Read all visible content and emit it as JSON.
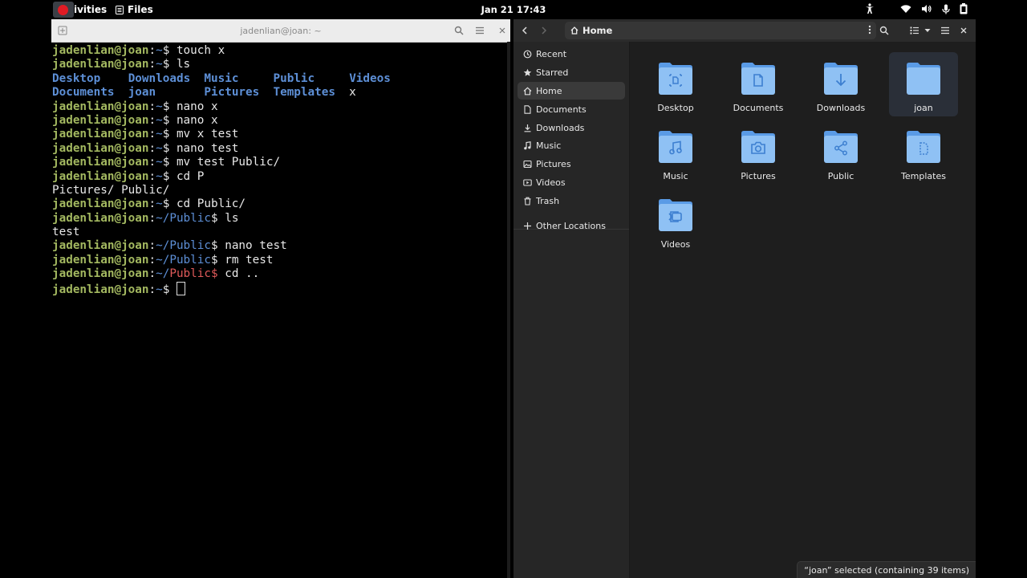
{
  "topbar": {
    "activities": "ivities",
    "app_menu": "Files",
    "clock": "Jan 21  17:43"
  },
  "terminal": {
    "title": "jadenlian@joan: ~",
    "lines": [
      [
        {
          "t": "jadenlian@joan",
          "c": "u"
        },
        {
          "t": ":"
        },
        {
          "t": "~",
          "c": "p"
        },
        {
          "t": "$ touch x"
        }
      ],
      [
        {
          "t": "jadenlian@joan",
          "c": "u"
        },
        {
          "t": ":"
        },
        {
          "t": "~",
          "c": "p"
        },
        {
          "t": "$ ls"
        }
      ],
      [
        {
          "t": "Desktop",
          "c": "dir"
        },
        {
          "t": "    "
        },
        {
          "t": "Downloads",
          "c": "dir"
        },
        {
          "t": "  "
        },
        {
          "t": "Music",
          "c": "dir"
        },
        {
          "t": "     "
        },
        {
          "t": "Public",
          "c": "dir"
        },
        {
          "t": "     "
        },
        {
          "t": "Videos",
          "c": "dir"
        }
      ],
      [
        {
          "t": "Documents",
          "c": "dir"
        },
        {
          "t": "  "
        },
        {
          "t": "joan",
          "c": "dir"
        },
        {
          "t": "       "
        },
        {
          "t": "Pictures",
          "c": "dir"
        },
        {
          "t": "  "
        },
        {
          "t": "Templates",
          "c": "dir"
        },
        {
          "t": "  x"
        }
      ],
      [
        {
          "t": "jadenlian@joan",
          "c": "u"
        },
        {
          "t": ":"
        },
        {
          "t": "~",
          "c": "p"
        },
        {
          "t": "$ nano x"
        }
      ],
      [
        {
          "t": "jadenlian@joan",
          "c": "u"
        },
        {
          "t": ":"
        },
        {
          "t": "~",
          "c": "p"
        },
        {
          "t": "$ nano x"
        }
      ],
      [
        {
          "t": "jadenlian@joan",
          "c": "u"
        },
        {
          "t": ":"
        },
        {
          "t": "~",
          "c": "p"
        },
        {
          "t": "$ mv x test"
        }
      ],
      [
        {
          "t": "jadenlian@joan",
          "c": "u"
        },
        {
          "t": ":"
        },
        {
          "t": "~",
          "c": "p"
        },
        {
          "t": "$ nano test"
        }
      ],
      [
        {
          "t": "jadenlian@joan",
          "c": "u"
        },
        {
          "t": ":"
        },
        {
          "t": "~",
          "c": "p"
        },
        {
          "t": "$ mv test Public/"
        }
      ],
      [
        {
          "t": "jadenlian@joan",
          "c": "u"
        },
        {
          "t": ":"
        },
        {
          "t": "~",
          "c": "p"
        },
        {
          "t": "$ cd P"
        }
      ],
      [
        {
          "t": "Pictures/ Public/"
        }
      ],
      [
        {
          "t": "jadenlian@joan",
          "c": "u"
        },
        {
          "t": ":"
        },
        {
          "t": "~",
          "c": "p"
        },
        {
          "t": "$ cd Public/"
        }
      ],
      [
        {
          "t": "jadenlian@joan",
          "c": "u"
        },
        {
          "t": ":"
        },
        {
          "t": "~/Public",
          "c": "p"
        },
        {
          "t": "$ ls"
        }
      ],
      [
        {
          "t": "test"
        }
      ],
      [
        {
          "t": "jadenlian@joan",
          "c": "u"
        },
        {
          "t": ":"
        },
        {
          "t": "~/Public",
          "c": "p"
        },
        {
          "t": "$ nano test"
        }
      ],
      [
        {
          "t": "jadenlian@joan",
          "c": "u"
        },
        {
          "t": ":"
        },
        {
          "t": "~/Public",
          "c": "p"
        },
        {
          "t": "$ rm test"
        }
      ],
      [
        {
          "t": "jadenlian@joan",
          "c": "u"
        },
        {
          "t": ":"
        },
        {
          "t": "~/",
          "c": "p"
        },
        {
          "t": "Public$",
          "c": "err"
        },
        {
          "t": " cd .."
        }
      ],
      [
        {
          "t": "jadenlian@joan",
          "c": "u"
        },
        {
          "t": ":"
        },
        {
          "t": "~",
          "c": "p"
        },
        {
          "t": "$ "
        }
      ]
    ]
  },
  "files": {
    "location": "Home",
    "sidebar": [
      {
        "label": "Recent",
        "icon": "clock-icon"
      },
      {
        "label": "Starred",
        "icon": "star-icon"
      },
      {
        "label": "Home",
        "icon": "home-icon",
        "active": true
      },
      {
        "label": "Documents",
        "icon": "document-icon"
      },
      {
        "label": "Downloads",
        "icon": "download-icon"
      },
      {
        "label": "Music",
        "icon": "music-icon"
      },
      {
        "label": "Pictures",
        "icon": "picture-icon"
      },
      {
        "label": "Videos",
        "icon": "video-icon"
      },
      {
        "label": "Trash",
        "icon": "trash-icon"
      },
      {
        "label": "Other Locations",
        "icon": "plus-icon"
      }
    ],
    "items": [
      {
        "label": "Desktop",
        "emblem": "desktop"
      },
      {
        "label": "Documents",
        "emblem": "document"
      },
      {
        "label": "Downloads",
        "emblem": "download"
      },
      {
        "label": "joan",
        "emblem": "none",
        "selected": true
      },
      {
        "label": "Music",
        "emblem": "music"
      },
      {
        "label": "Pictures",
        "emblem": "camera"
      },
      {
        "label": "Public",
        "emblem": "share"
      },
      {
        "label": "Templates",
        "emblem": "template"
      },
      {
        "label": "Videos",
        "emblem": "video"
      }
    ],
    "status": "“joan” selected (containing 39 items)"
  },
  "colors": {
    "prompt_user": "#a3b860",
    "prompt_path": "#5d8fd6",
    "folder_body": "#8fc1f4",
    "folder_tab": "#5a9be6",
    "folder_emblem": "#3d7fd0"
  }
}
